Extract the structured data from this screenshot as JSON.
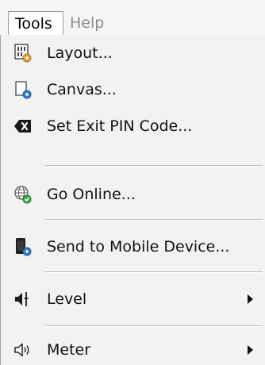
{
  "menubar": {
    "tools_label": "Tools",
    "help_label": "Help"
  },
  "menu": {
    "items": [
      {
        "label": "Layout...",
        "icon": "layout-icon"
      },
      {
        "label": "Canvas...",
        "icon": "canvas-icon"
      },
      {
        "label": "Set Exit PIN Code...",
        "icon": "backspace-icon"
      },
      {
        "label": "Go Online...",
        "icon": "globe-icon"
      },
      {
        "label": "Send to Mobile Device...",
        "icon": "mobile-device-icon"
      },
      {
        "label": "Level",
        "icon": "level-icon",
        "submenu": true
      },
      {
        "label": "Meter",
        "icon": "speaker-icon",
        "submenu": true
      }
    ]
  },
  "colors": {
    "menu_bg": "#f2f2f2",
    "disabled_text": "#8d8d8d",
    "accent_blue": "#2f7fd0",
    "accent_orange": "#e8a33a",
    "accent_green": "#3aaa3a"
  }
}
